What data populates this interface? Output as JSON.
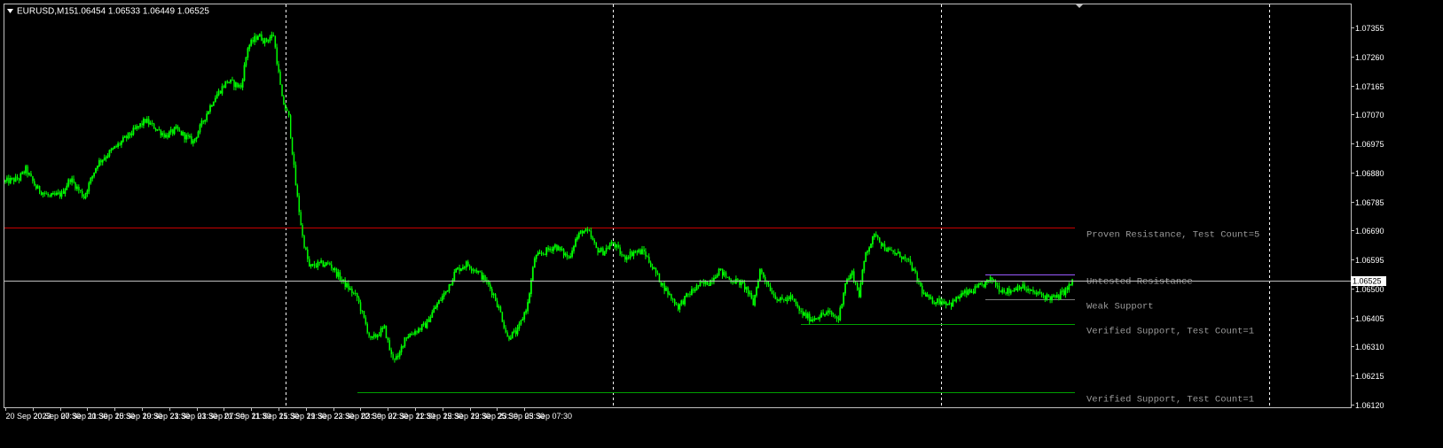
{
  "header": {
    "symbol": "EURUSD,M15",
    "ohlc": "1.06454 1.06533 1.06449 1.06525"
  },
  "colors": {
    "background": "#000000",
    "frame": "#c0c0c0",
    "axis_text": "#ffffff",
    "candle": "#00ff00",
    "grid": "#ffffff",
    "resistance_line": "#c80000",
    "untested_line": "#9a5aff",
    "support_line": "#00a000",
    "zone_label": "#9a9a9a",
    "bid_line": "#c0c0c0",
    "price_box_bg": "#ffffff",
    "price_box_text": "#000000"
  },
  "current_price_label": "1.06525",
  "chart_data": {
    "type": "candlestick",
    "title": "EURUSD,M15",
    "x_tick_labels": [
      "20 Sep 2023",
      "20 Sep 07:30",
      "20 Sep 11:30",
      "20 Sep 15:30",
      "20 Sep 19:30",
      "20 Sep 23:30",
      "21 Sep 03:30",
      "21 Sep 07:30",
      "21 Sep 11:30",
      "21 Sep 15:30",
      "21 Sep 19:30",
      "21 Sep 23:30",
      "22 Sep 03:30",
      "22 Sep 07:30",
      "22 Sep 11:30",
      "22 Sep 15:30",
      "22 Sep 19:30",
      "22 Sep 23:30",
      "25 Sep 03:30",
      "25 Sep 07:30"
    ],
    "y_tick_labels": [
      "1.07355",
      "1.07260",
      "1.07165",
      "1.07070",
      "1.06975",
      "1.06880",
      "1.06785",
      "1.06690",
      "1.06595",
      "1.06500",
      "1.06405",
      "1.06310",
      "1.06215",
      "1.06120"
    ],
    "ylim": [
      1.061,
      1.074
    ],
    "grid": "vertical dashed",
    "bars_per_label": 16,
    "close_path": [
      [
        0,
        1.0685
      ],
      [
        8,
        1.0686
      ],
      [
        12,
        1.0689
      ],
      [
        18,
        1.0683
      ],
      [
        26,
        1.068
      ],
      [
        33,
        1.0681
      ],
      [
        38,
        1.0686
      ],
      [
        46,
        1.068
      ],
      [
        54,
        1.0691
      ],
      [
        66,
        1.0697
      ],
      [
        82,
        1.0705
      ],
      [
        94,
        1.07
      ],
      [
        100,
        1.0702
      ],
      [
        110,
        1.0698
      ],
      [
        122,
        1.0712
      ],
      [
        130,
        1.0718
      ],
      [
        138,
        1.0716
      ],
      [
        142,
        1.0729
      ],
      [
        148,
        1.0733
      ],
      [
        152,
        1.0731
      ],
      [
        157,
        1.0733
      ],
      [
        162,
        1.0712
      ],
      [
        166,
        1.0706
      ],
      [
        170,
        1.0684
      ],
      [
        174,
        1.0667
      ],
      [
        178,
        1.0657
      ],
      [
        184,
        1.0658
      ],
      [
        190,
        1.0658
      ],
      [
        198,
        1.0652
      ],
      [
        206,
        1.0647
      ],
      [
        214,
        1.0633
      ],
      [
        222,
        1.0637
      ],
      [
        226,
        1.0628
      ],
      [
        230,
        1.0627
      ],
      [
        234,
        1.0634
      ],
      [
        240,
        1.0636
      ],
      [
        246,
        1.0638
      ],
      [
        252,
        1.0644
      ],
      [
        258,
        1.0649
      ],
      [
        264,
        1.0656
      ],
      [
        270,
        1.0658
      ],
      [
        276,
        1.0656
      ],
      [
        282,
        1.0652
      ],
      [
        286,
        1.0648
      ],
      [
        290,
        1.0642
      ],
      [
        294,
        1.0634
      ],
      [
        300,
        1.0636
      ],
      [
        306,
        1.0645
      ],
      [
        310,
        1.066
      ],
      [
        316,
        1.0662
      ],
      [
        322,
        1.0664
      ],
      [
        326,
        1.0662
      ],
      [
        330,
        1.066
      ],
      [
        334,
        1.0666
      ],
      [
        338,
        1.0669
      ],
      [
        342,
        1.0668
      ],
      [
        346,
        1.0663
      ],
      [
        350,
        1.0662
      ],
      [
        356,
        1.0665
      ],
      [
        362,
        1.066
      ],
      [
        368,
        1.0662
      ],
      [
        374,
        1.0662
      ],
      [
        378,
        1.0658
      ],
      [
        384,
        1.0652
      ],
      [
        390,
        1.0647
      ],
      [
        394,
        1.0644
      ],
      [
        400,
        1.0648
      ],
      [
        406,
        1.0651
      ],
      [
        412,
        1.0652
      ],
      [
        418,
        1.0656
      ],
      [
        424,
        1.0653
      ],
      [
        430,
        1.0652
      ],
      [
        434,
        1.065
      ],
      [
        438,
        1.0645
      ],
      [
        442,
        1.0656
      ],
      [
        446,
        1.0652
      ],
      [
        450,
        1.0648
      ],
      [
        454,
        1.0646
      ],
      [
        460,
        1.0647
      ],
      [
        466,
        1.0642
      ],
      [
        472,
        1.064
      ],
      [
        476,
        1.0641
      ],
      [
        482,
        1.0642
      ],
      [
        488,
        1.064
      ],
      [
        492,
        1.0652
      ],
      [
        496,
        1.0655
      ],
      [
        500,
        1.0648
      ],
      [
        504,
        1.0662
      ],
      [
        510,
        1.0668
      ],
      [
        514,
        1.0664
      ],
      [
        518,
        1.0662
      ],
      [
        524,
        1.0661
      ],
      [
        530,
        1.0658
      ],
      [
        534,
        1.0653
      ],
      [
        538,
        1.0648
      ],
      [
        542,
        1.0646
      ],
      [
        548,
        1.0646
      ],
      [
        554,
        1.0645
      ],
      [
        560,
        1.0648
      ],
      [
        566,
        1.0649
      ],
      [
        572,
        1.0651
      ],
      [
        578,
        1.0653
      ],
      [
        582,
        1.065
      ],
      [
        588,
        1.0649
      ],
      [
        594,
        1.0651
      ],
      [
        600,
        1.0649
      ],
      [
        606,
        1.0648
      ],
      [
        612,
        1.0647
      ],
      [
        616,
        1.0647
      ],
      [
        622,
        1.065
      ],
      [
        625,
        1.0652
      ]
    ],
    "zones": [
      {
        "label": "Proven Resistance, Test Count=5",
        "price": 1.067,
        "start_bar": 0,
        "kind": "resistance"
      },
      {
        "label": "Untested Resistance",
        "price": 1.06545,
        "start_bar": 574,
        "kind": "untested"
      },
      {
        "label": "Weak Support",
        "price": 1.06465,
        "start_bar": 574,
        "kind": "weak"
      },
      {
        "label": "Verified Support, Test Count=1",
        "price": 1.06385,
        "start_bar": 466,
        "kind": "support"
      },
      {
        "label": "Verified Support, Test Count=1",
        "price": 1.0616,
        "start_bar": 206,
        "kind": "support"
      }
    ],
    "current_price": 1.06525
  }
}
